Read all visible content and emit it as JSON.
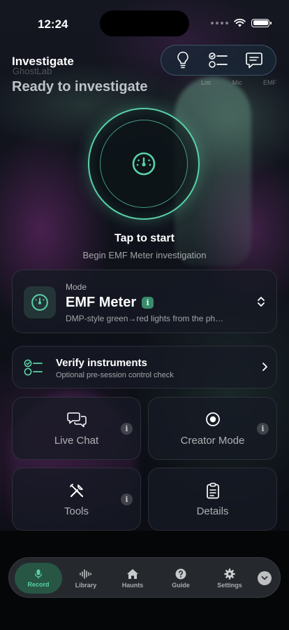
{
  "status_bar": {
    "time": "12:24"
  },
  "header": {
    "title": "Investigate",
    "brand_watermark": "GhostLab",
    "subtitle": "Ready to investigate",
    "permission_labels": [
      "Loc",
      "Mic",
      "EMF"
    ]
  },
  "toolbar": {
    "icons": [
      "lightbulb-icon",
      "checklist-icon",
      "chat-bubble-icon"
    ]
  },
  "record": {
    "title": "Tap to start",
    "subtitle": "Begin EMF Meter investigation"
  },
  "mode": {
    "label": "Mode",
    "name": "EMF Meter",
    "info": "i",
    "description": "DMP-style green→red lights from the ph…"
  },
  "verify": {
    "title": "Verify instruments",
    "subtitle": "Optional pre-session control check"
  },
  "tiles": [
    {
      "label": "Live Chat",
      "info": "i"
    },
    {
      "label": "Creator Mode",
      "info": "i"
    },
    {
      "label": "Tools",
      "info": "i"
    },
    {
      "label": "Details"
    }
  ],
  "tabbar": {
    "tabs": [
      {
        "label": "Record",
        "icon": "mic-icon",
        "active": true
      },
      {
        "label": "Library",
        "icon": "waveform-icon"
      },
      {
        "label": "Haunts",
        "icon": "house-icon"
      },
      {
        "label": "Guide",
        "icon": "question-icon"
      },
      {
        "label": "Settings",
        "icon": "gear-icon"
      }
    ]
  },
  "colors": {
    "accent": "#5ad1a7",
    "background": "#0b0d14",
    "card": "#161a24"
  }
}
